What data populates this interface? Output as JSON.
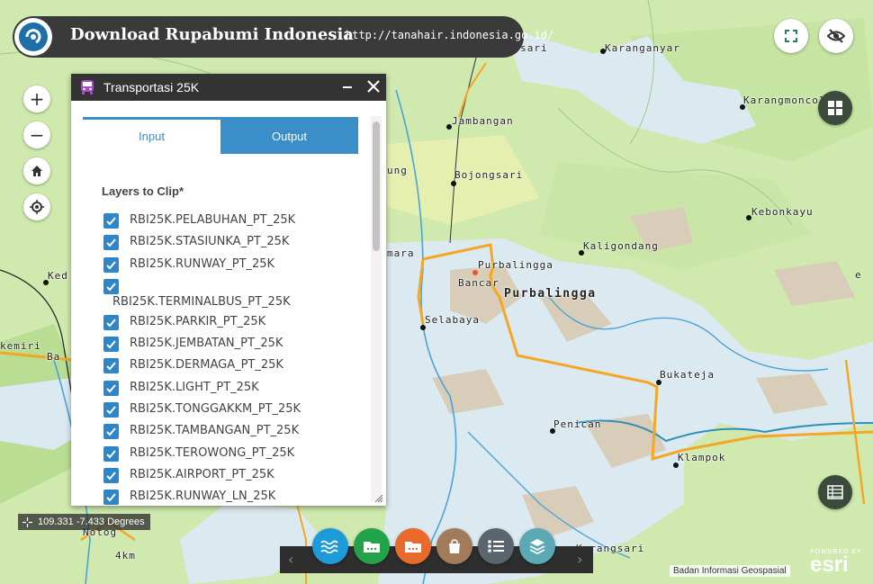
{
  "header": {
    "title": "Download Rupabumi Indonesia",
    "url": "http://tanahair.indonesia.go.id/"
  },
  "panel": {
    "title": "Transportasi 25K",
    "tabs": [
      {
        "label": "Input"
      },
      {
        "label": "Output"
      }
    ],
    "section_label": "Layers to Clip*",
    "layers": [
      "RBI25K.PELABUHAN_PT_25K",
      "RBI25K.STASIUNKA_PT_25K",
      "RBI25K.RUNWAY_PT_25K",
      "RBI25K.TERMINALBUS_PT_25K",
      "RBI25K.PARKIR_PT_25K",
      "RBI25K.JEMBATAN_PT_25K",
      "RBI25K.DERMAGA_PT_25K",
      "RBI25K.LIGHT_PT_25K",
      "RBI25K.TONGGAKKM_PT_25K",
      "RBI25K.TAMBANGAN_PT_25K",
      "RBI25K.TEROWONG_PT_25K",
      "RBI25K.AIRPORT_PT_25K",
      "RBI25K.RUNWAY_LN_25K"
    ]
  },
  "coords": "109.331 -7.433 Degrees",
  "scale_label": "4km",
  "attribution": "Badan Informasi Geospasial",
  "esri": {
    "powered": "POWERED BY",
    "brand": "esri"
  },
  "places": {
    "gobotsari": "Gobotsari",
    "karanganyar": "Karanganyar",
    "jambangan": "Jambangan",
    "karangmoncol": "Karangmoncol",
    "bojongsari": "Bojongsari",
    "ung": "ung",
    "kebonkayu": "Kebonkayu",
    "kaligondang": "Kaligondang",
    "mara": "mara",
    "purbalingga_small": "Purbalingga",
    "bancar": "Bancar",
    "purbalingga": "Purbalingga",
    "selabaya": "Selabaya",
    "ked": "Ked",
    "kemiri": "kemiri",
    "ba": "Ba",
    "bukateja": "Bukateja",
    "penican": "Penican",
    "klampok": "Klampok",
    "notog": "Notog",
    "karangsari": "Karangsari",
    "e": "e"
  },
  "colors": {
    "accent": "#3a8fc9",
    "header": "#3a3a3a",
    "road": "#f5a623"
  }
}
